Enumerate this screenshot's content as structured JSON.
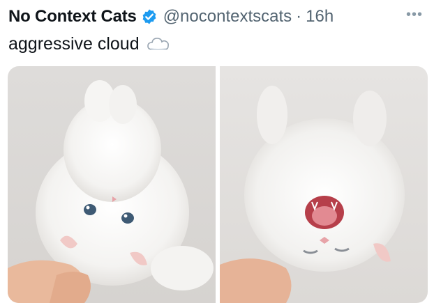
{
  "tweet": {
    "display_name": "No Context Cats",
    "verified_icon": "verified-badge-icon",
    "handle": "@nocontextscats",
    "separator": "·",
    "timestamp": "16h",
    "more_icon": "more-options-icon",
    "more_glyph": "•••",
    "text": "aggressive cloud",
    "emoji_icon": "cloud-icon"
  },
  "colors": {
    "text": "#0f1419",
    "secondary": "#536471",
    "verified_blue": "#1d9bf0",
    "photo_background": "#e4e2e0"
  },
  "media": {
    "photos": [
      {
        "subject": "white-fluffy-cat-held-upside-down"
      },
      {
        "subject": "white-fluffy-cat-mouth-open"
      }
    ]
  }
}
